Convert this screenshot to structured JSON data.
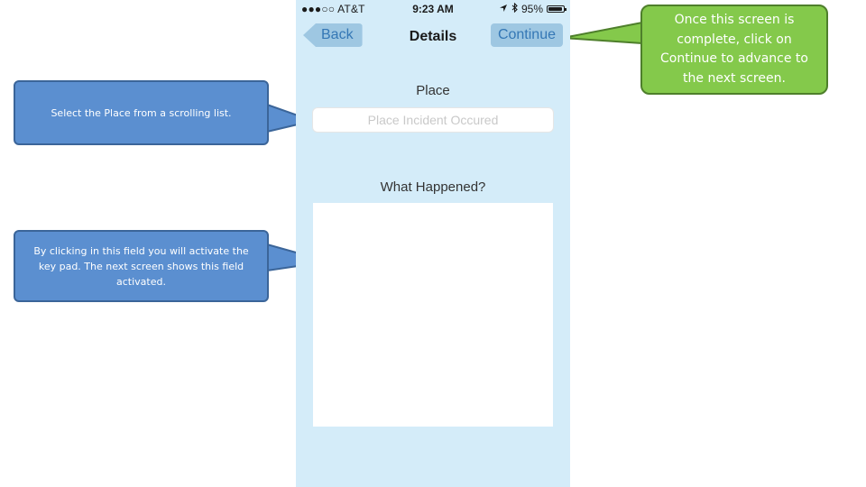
{
  "status_bar": {
    "carrier": "●●●○○ AT&T",
    "time": "9:23 AM",
    "battery": "95%",
    "battery_level": 0.95
  },
  "navbar": {
    "back_label": "Back",
    "title": "Details",
    "continue_label": "Continue"
  },
  "form": {
    "place_label": "Place",
    "place_placeholder": "Place Incident Occured",
    "what_label": "What Happened?"
  },
  "callouts": {
    "place": "Select the Place from a scrolling list.",
    "field": "By clicking in this field you will activate the key pad.  The next screen shows this field activated.",
    "continue": "Once this screen is complete, click on Continue to advance to the next screen."
  },
  "colors": {
    "phone_bg": "#d4ecf9",
    "ios_button": "#3477b5",
    "callout_blue": "#5b8fd0",
    "callout_green": "#84c94b"
  }
}
